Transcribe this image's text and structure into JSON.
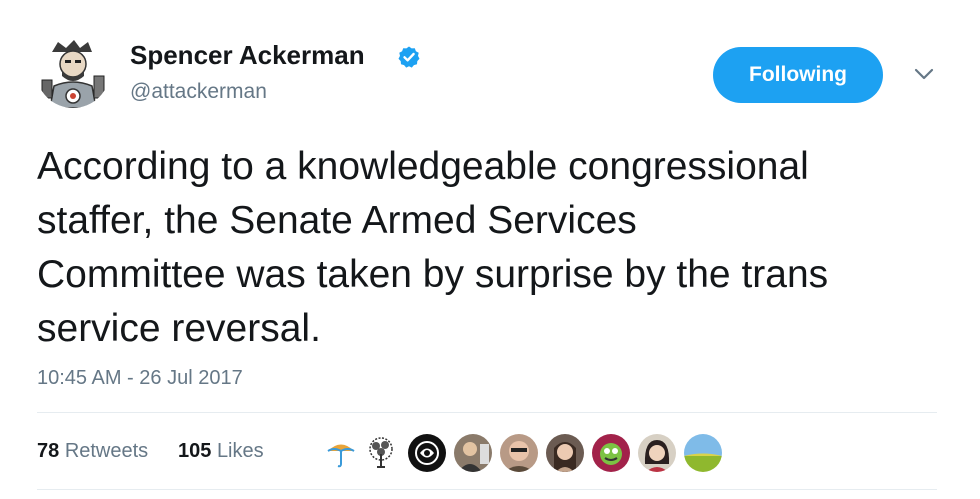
{
  "author": {
    "display_name": "Spencer Ackerman",
    "handle": "@attackerman",
    "verified": true,
    "avatar_icon": "illustrated-portrait-avatar"
  },
  "follow_button": {
    "label": "Following",
    "color": "#1da1f2"
  },
  "menu": {
    "icon": "chevron-down-icon"
  },
  "tweet": {
    "text": "According to a knowledgeable congressional\nstaffer, the Senate Armed Services\nCommittee was taken by surprise by the trans\nservice reversal.",
    "timestamp": "10:45 AM - 26 Jul 2017"
  },
  "stats": {
    "retweets_count": "78",
    "retweets_label": "Retweets",
    "likes_count": "105",
    "likes_label": "Likes"
  },
  "likers": [
    {
      "icon": "umbrella-avatar"
    },
    {
      "icon": "tree-avatar"
    },
    {
      "icon": "dark-logo-avatar"
    },
    {
      "icon": "person-avatar"
    },
    {
      "icon": "person-avatar"
    },
    {
      "icon": "person-avatar"
    },
    {
      "icon": "cartoon-avatar"
    },
    {
      "icon": "person-avatar"
    },
    {
      "icon": "landscape-avatar"
    }
  ],
  "colors": {
    "text": "#14171a",
    "muted": "#657786",
    "accent": "#1da1f2",
    "divider": "#e6ecf0"
  }
}
